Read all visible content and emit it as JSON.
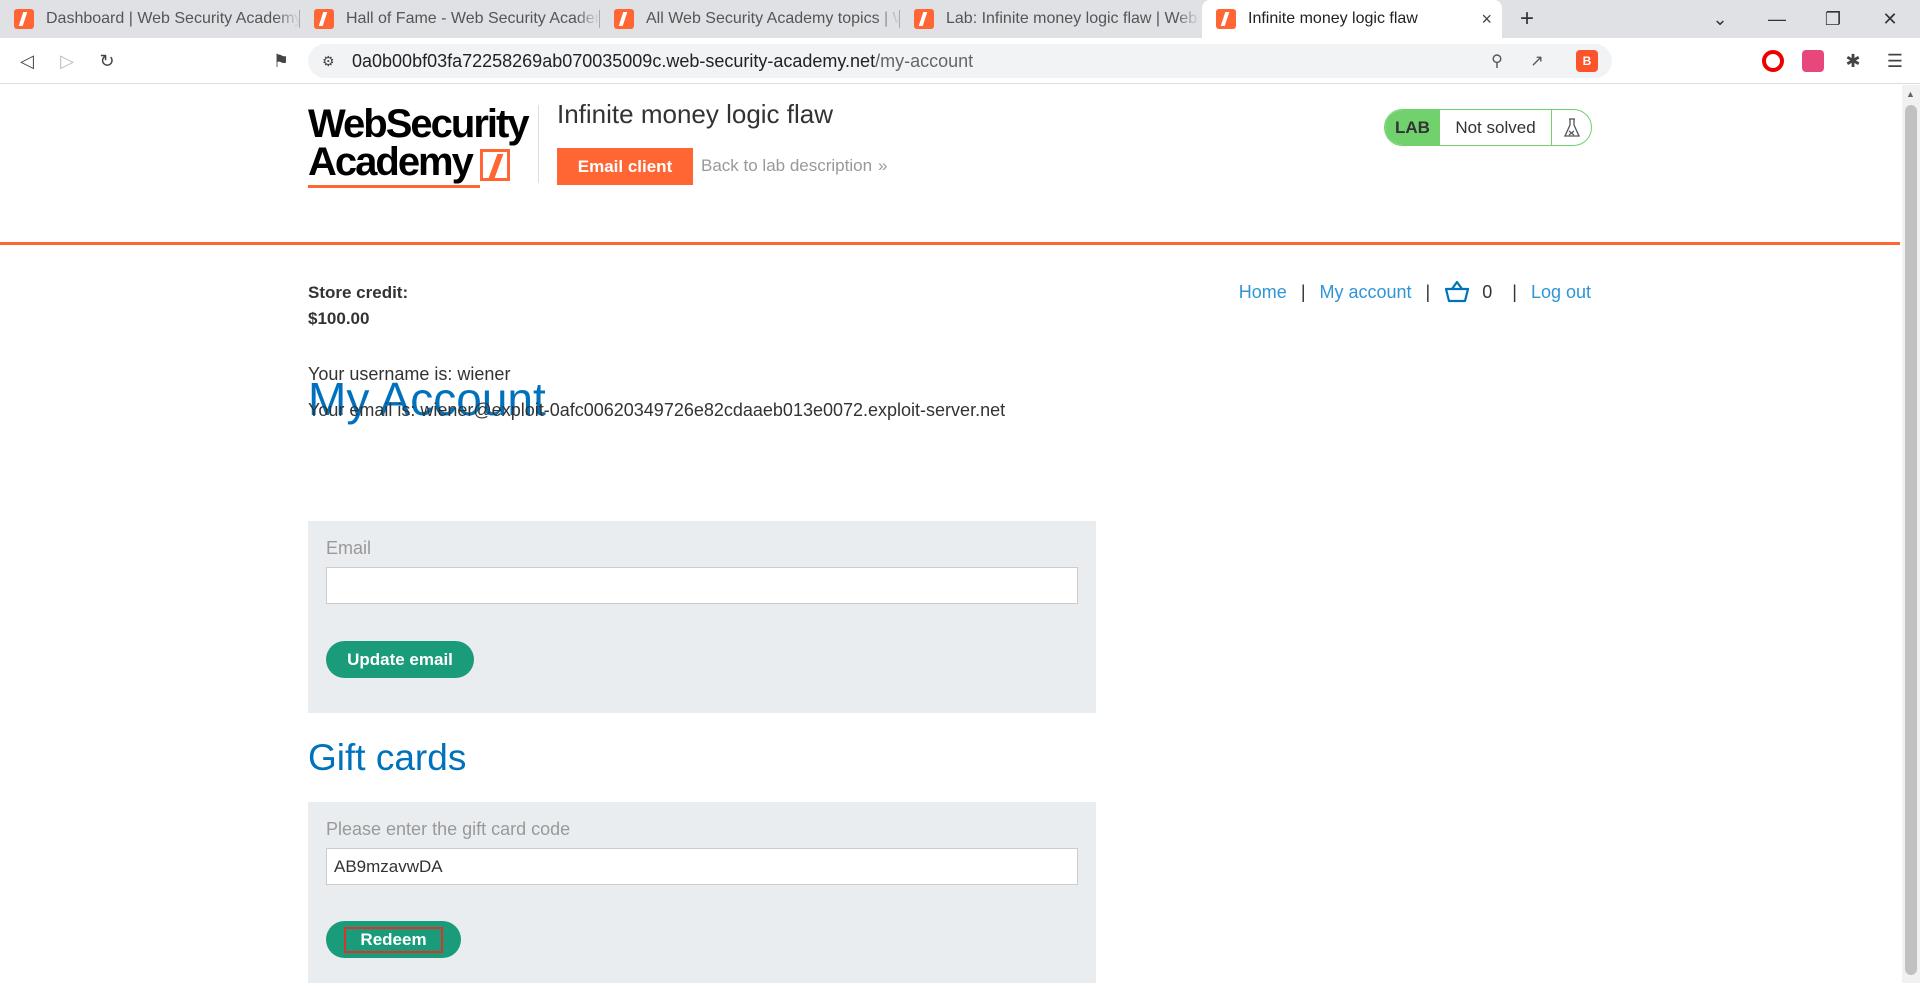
{
  "browser": {
    "tabs": [
      {
        "title": "Dashboard | Web Security Academy",
        "active": false
      },
      {
        "title": "Hall of Fame - Web Security Academy",
        "active": false
      },
      {
        "title": "All Web Security Academy topics | Web",
        "active": false
      },
      {
        "title": "Lab: Infinite money logic flaw | Web",
        "active": false
      },
      {
        "title": "Infinite money logic flaw",
        "active": true
      }
    ],
    "new_tab_symbol": "+",
    "close_tab_symbol": "×",
    "url_host": "0a0b00bf03fa72258269ab070035009c.web-security-academy.net",
    "url_path": "/my-account",
    "icons": [
      "back-icon",
      "forward-icon",
      "reload-icon",
      "bookmark-icon",
      "site-info-icon",
      "zoom-icon",
      "share-icon",
      "brave-shields-icon",
      "opera-extension-icon",
      "translate-extension-icon",
      "extensions-icon",
      "menu-icon"
    ]
  },
  "lab": {
    "logo_line1": "WebSecurity",
    "logo_line2": "Academy",
    "title": "Infinite money logic flaw",
    "email_client_label": "Email client",
    "back_link_label": "Back to lab description",
    "back_chevron": "»",
    "status_badge": "LAB",
    "status_text": "Not solved",
    "colors": {
      "accent": "#ff6633",
      "solved_green": "#70d16d",
      "link_blue": "#0071bc",
      "button_teal": "#1a9c7a"
    }
  },
  "store": {
    "credit_label": "Store credit:",
    "credit_value": "$100.00"
  },
  "nav": {
    "home": "Home",
    "my_account": "My account",
    "cart_count": "0",
    "logout": "Log out",
    "separator": "|"
  },
  "account": {
    "heading": "My Account",
    "username_line": "Your username is: wiener",
    "email_line": "Your email is: wiener@exploit-0afc00620349726e82cdaaeb013e0072.exploit-server.net",
    "email_form": {
      "label": "Email",
      "value": "",
      "button": "Update email"
    }
  },
  "gift_cards": {
    "heading": "Gift cards",
    "label": "Please enter the gift card code",
    "value": "AB9mzavwDA",
    "button": "Redeem"
  }
}
